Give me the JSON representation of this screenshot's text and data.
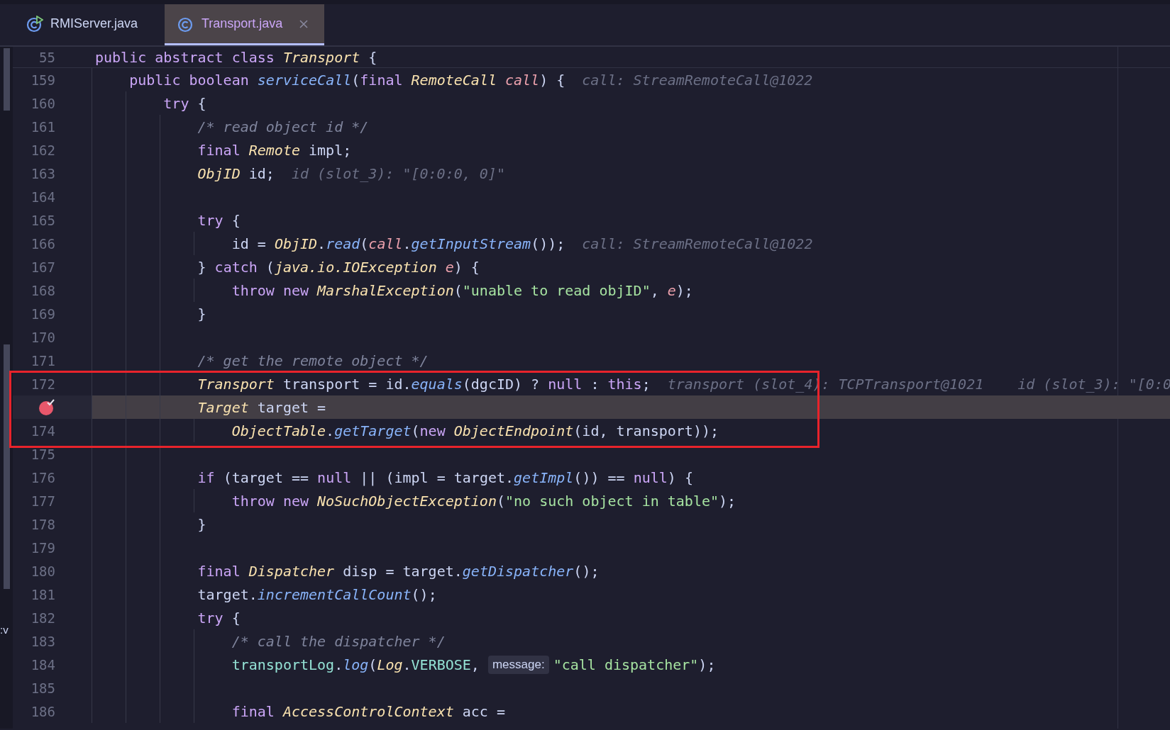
{
  "tabs": [
    {
      "label": "RMIServer.java",
      "selected": false,
      "runnable": true
    },
    {
      "label": "Transport.java",
      "selected": true,
      "runnable": false
    }
  ],
  "side_fragment": ":v",
  "sticky_line": {
    "number": "55",
    "tokens": [
      {
        "kind": "kw",
        "t": "public abstract class "
      },
      {
        "kind": "type",
        "t": "Transport"
      },
      {
        "kind": "plain",
        "t": " {"
      }
    ]
  },
  "lines": [
    {
      "number": "159",
      "breakpoint": false,
      "current": false,
      "boxed": false,
      "tokens": [
        {
          "kind": "kw",
          "t": "    public boolean "
        },
        {
          "kind": "method",
          "t": "serviceCall"
        },
        {
          "kind": "plain",
          "t": "("
        },
        {
          "kind": "kw",
          "t": "final "
        },
        {
          "kind": "type",
          "t": "RemoteCall "
        },
        {
          "kind": "param",
          "t": "call"
        },
        {
          "kind": "plain",
          "t": ") {"
        }
      ],
      "hints": [
        "call: StreamRemoteCall@1022"
      ]
    },
    {
      "number": "160",
      "breakpoint": false,
      "current": false,
      "boxed": false,
      "tokens": [
        {
          "kind": "kw",
          "t": "        try"
        },
        {
          "kind": "plain",
          "t": " {"
        }
      ]
    },
    {
      "number": "161",
      "breakpoint": false,
      "current": false,
      "boxed": false,
      "tokens": [
        {
          "kind": "comment",
          "t": "            /* read object id */"
        }
      ]
    },
    {
      "number": "162",
      "breakpoint": false,
      "current": false,
      "boxed": false,
      "tokens": [
        {
          "kind": "kw",
          "t": "            final "
        },
        {
          "kind": "type",
          "t": "Remote"
        },
        {
          "kind": "plain",
          "t": " impl;"
        }
      ]
    },
    {
      "number": "163",
      "breakpoint": false,
      "current": false,
      "boxed": false,
      "tokens": [
        {
          "kind": "type",
          "t": "            ObjID"
        },
        {
          "kind": "plain",
          "t": " id;"
        }
      ],
      "hints": [
        "id (slot_3): \"[0:0:0, 0]\""
      ]
    },
    {
      "number": "164",
      "breakpoint": false,
      "current": false,
      "boxed": false
    },
    {
      "number": "165",
      "breakpoint": false,
      "current": false,
      "boxed": false,
      "tokens": [
        {
          "kind": "kw",
          "t": "            try"
        },
        {
          "kind": "plain",
          "t": " {"
        }
      ]
    },
    {
      "number": "166",
      "breakpoint": false,
      "current": false,
      "boxed": false,
      "tokens": [
        {
          "kind": "plain",
          "t": "                id = "
        },
        {
          "kind": "type",
          "t": "ObjID"
        },
        {
          "kind": "plain",
          "t": "."
        },
        {
          "kind": "method",
          "t": "read"
        },
        {
          "kind": "plain",
          "t": "("
        },
        {
          "kind": "param",
          "t": "call"
        },
        {
          "kind": "plain",
          "t": "."
        },
        {
          "kind": "method",
          "t": "getInputStream"
        },
        {
          "kind": "plain",
          "t": "());"
        }
      ],
      "hints": [
        "call: StreamRemoteCall@1022"
      ]
    },
    {
      "number": "167",
      "breakpoint": false,
      "current": false,
      "boxed": false,
      "tokens": [
        {
          "kind": "plain",
          "t": "            } "
        },
        {
          "kind": "kw",
          "t": "catch"
        },
        {
          "kind": "plain",
          "t": " ("
        },
        {
          "kind": "type",
          "t": "java.io.IOException "
        },
        {
          "kind": "param",
          "t": "e"
        },
        {
          "kind": "plain",
          "t": ") {"
        }
      ]
    },
    {
      "number": "168",
      "breakpoint": false,
      "current": false,
      "boxed": false,
      "tokens": [
        {
          "kind": "kw",
          "t": "                throw new "
        },
        {
          "kind": "type",
          "t": "MarshalException"
        },
        {
          "kind": "plain",
          "t": "("
        },
        {
          "kind": "string",
          "t": "\"unable to read objID\""
        },
        {
          "kind": "plain",
          "t": ", "
        },
        {
          "kind": "param",
          "t": "e"
        },
        {
          "kind": "plain",
          "t": ");"
        }
      ]
    },
    {
      "number": "169",
      "breakpoint": false,
      "current": false,
      "boxed": false,
      "tokens": [
        {
          "kind": "plain",
          "t": "            }"
        }
      ]
    },
    {
      "number": "170",
      "breakpoint": false,
      "current": false,
      "boxed": false
    },
    {
      "number": "171",
      "breakpoint": false,
      "current": false,
      "boxed": false,
      "tokens": [
        {
          "kind": "comment",
          "t": "            /* get the remote object */"
        }
      ]
    },
    {
      "number": "172",
      "breakpoint": false,
      "current": false,
      "boxed": true,
      "tokens": [
        {
          "kind": "type",
          "t": "            Transport"
        },
        {
          "kind": "plain",
          "t": " transport = id."
        },
        {
          "kind": "method",
          "t": "equals"
        },
        {
          "kind": "plain",
          "t": "(dgcID) ? "
        },
        {
          "kind": "kw",
          "t": "null"
        },
        {
          "kind": "plain",
          "t": " : "
        },
        {
          "kind": "kw",
          "t": "this"
        },
        {
          "kind": "plain",
          "t": ";"
        }
      ],
      "hints": [
        "transport (slot_4): TCPTransport@1021",
        "id (slot_3): \"[0:0"
      ]
    },
    {
      "breakpoint": true,
      "current": true,
      "boxed": true,
      "tokens": [
        {
          "kind": "type",
          "t": "            Target"
        },
        {
          "kind": "plain",
          "t": " target ="
        }
      ]
    },
    {
      "number": "174",
      "breakpoint": false,
      "current": false,
      "boxed": true,
      "tokens": [
        {
          "kind": "type",
          "t": "                ObjectTable"
        },
        {
          "kind": "plain",
          "t": "."
        },
        {
          "kind": "method",
          "t": "getTarget"
        },
        {
          "kind": "plain",
          "t": "("
        },
        {
          "kind": "kw",
          "t": "new "
        },
        {
          "kind": "type",
          "t": "ObjectEndpoint"
        },
        {
          "kind": "plain",
          "t": "(id, transport));"
        }
      ]
    },
    {
      "number": "175",
      "breakpoint": false,
      "current": false,
      "boxed": false
    },
    {
      "number": "176",
      "breakpoint": false,
      "current": false,
      "boxed": false,
      "tokens": [
        {
          "kind": "kw",
          "t": "            if"
        },
        {
          "kind": "plain",
          "t": " (target == "
        },
        {
          "kind": "kw",
          "t": "null"
        },
        {
          "kind": "plain",
          "t": " || (impl = target."
        },
        {
          "kind": "method",
          "t": "getImpl"
        },
        {
          "kind": "plain",
          "t": "()) == "
        },
        {
          "kind": "kw",
          "t": "null"
        },
        {
          "kind": "plain",
          "t": ") {"
        }
      ]
    },
    {
      "number": "177",
      "breakpoint": false,
      "current": false,
      "boxed": false,
      "tokens": [
        {
          "kind": "kw",
          "t": "                throw new "
        },
        {
          "kind": "type",
          "t": "NoSuchObjectException"
        },
        {
          "kind": "plain",
          "t": "("
        },
        {
          "kind": "string",
          "t": "\"no such object in table\""
        },
        {
          "kind": "plain",
          "t": ");"
        }
      ]
    },
    {
      "number": "178",
      "breakpoint": false,
      "current": false,
      "boxed": false,
      "tokens": [
        {
          "kind": "plain",
          "t": "            }"
        }
      ]
    },
    {
      "number": "179",
      "breakpoint": false,
      "current": false,
      "boxed": false
    },
    {
      "number": "180",
      "breakpoint": false,
      "current": false,
      "boxed": false,
      "tokens": [
        {
          "kind": "kw",
          "t": "            final "
        },
        {
          "kind": "type",
          "t": "Dispatcher"
        },
        {
          "kind": "plain",
          "t": " disp = target."
        },
        {
          "kind": "method",
          "t": "getDispatcher"
        },
        {
          "kind": "plain",
          "t": "();"
        }
      ]
    },
    {
      "number": "181",
      "breakpoint": false,
      "current": false,
      "boxed": false,
      "tokens": [
        {
          "kind": "plain",
          "t": "            target."
        },
        {
          "kind": "method",
          "t": "incrementCallCount"
        },
        {
          "kind": "plain",
          "t": "();"
        }
      ]
    },
    {
      "number": "182",
      "breakpoint": false,
      "current": false,
      "boxed": false,
      "tokens": [
        {
          "kind": "kw",
          "t": "            try"
        },
        {
          "kind": "plain",
          "t": " {"
        }
      ]
    },
    {
      "number": "183",
      "breakpoint": false,
      "current": false,
      "boxed": false,
      "tokens": [
        {
          "kind": "comment",
          "t": "                /* call the dispatcher */"
        }
      ]
    },
    {
      "number": "184",
      "breakpoint": false,
      "current": false,
      "boxed": false,
      "tokens": [
        {
          "kind": "field",
          "t": "                transportLog"
        },
        {
          "kind": "plain",
          "t": "."
        },
        {
          "kind": "method",
          "t": "log"
        },
        {
          "kind": "plain",
          "t": "("
        },
        {
          "kind": "type",
          "t": "Log"
        },
        {
          "kind": "plain",
          "t": "."
        },
        {
          "kind": "field",
          "t": "VERBOSE"
        },
        {
          "kind": "plain",
          "t": ", "
        },
        {
          "kind": "inlay",
          "t": "message:"
        },
        {
          "kind": "string",
          "t": "\"call dispatcher\""
        },
        {
          "kind": "plain",
          "t": ");"
        }
      ]
    },
    {
      "number": "185",
      "breakpoint": false,
      "current": false,
      "boxed": false
    },
    {
      "number": "186",
      "breakpoint": false,
      "current": false,
      "boxed": false,
      "tokens": [
        {
          "kind": "kw",
          "t": "                final "
        },
        {
          "kind": "type",
          "t": "AccessControlContext"
        },
        {
          "kind": "plain",
          "t": " acc ="
        }
      ]
    }
  ]
}
